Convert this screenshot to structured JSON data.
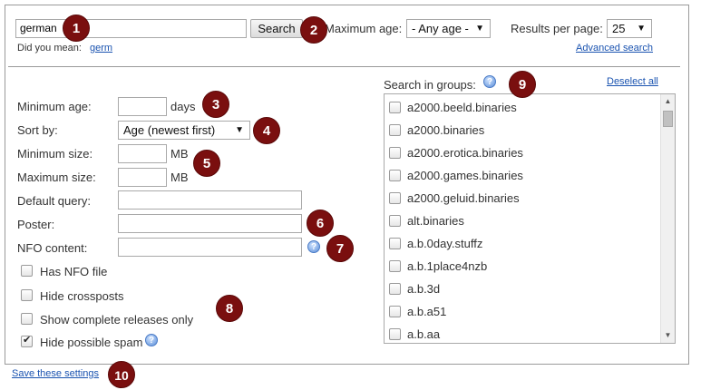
{
  "search": {
    "query": "german",
    "button_label": "Search",
    "did_you_mean_label": "Did you mean:",
    "did_you_mean_suggestion": "germ",
    "max_age_label": "Maximum age:",
    "max_age_value": "- Any age -",
    "results_per_page_label": "Results per page:",
    "results_per_page_value": "25",
    "advanced_search_link": "Advanced search"
  },
  "filters": {
    "min_age_label": "Minimum age:",
    "min_age_value": "",
    "min_age_unit": "days",
    "sort_by_label": "Sort by:",
    "sort_by_value": "Age (newest first)",
    "min_size_label": "Minimum size:",
    "min_size_value": "",
    "min_size_unit": "MB",
    "max_size_label": "Maximum size:",
    "max_size_value": "",
    "max_size_unit": "MB",
    "default_query_label": "Default query:",
    "default_query_value": "",
    "poster_label": "Poster:",
    "poster_value": "",
    "nfo_content_label": "NFO content:",
    "nfo_content_value": ""
  },
  "options": [
    {
      "label": "Has NFO file",
      "checked": false
    },
    {
      "label": "Hide crossposts",
      "checked": false
    },
    {
      "label": "Show complete releases only",
      "checked": false
    },
    {
      "label": "Hide possible spam",
      "checked": true
    }
  ],
  "groups": {
    "header_label": "Search in groups:",
    "deselect_all_link": "Deselect all",
    "items": [
      "a2000.beeld.binaries",
      "a2000.binaries",
      "a2000.erotica.binaries",
      "a2000.games.binaries",
      "a2000.geluid.binaries",
      "alt.binaries",
      "a.b.0day.stuffz",
      "a.b.1place4nzb",
      "a.b.3d",
      "a.b.a51",
      "a.b.aa"
    ]
  },
  "footer": {
    "save_settings_link": "Save these settings"
  },
  "callouts": [
    "1",
    "2",
    "3",
    "4",
    "5",
    "6",
    "7",
    "8",
    "9",
    "10"
  ],
  "colors": {
    "callout": "#7a0f0f",
    "link": "#1a53b0",
    "border": "#9a9a9a"
  }
}
